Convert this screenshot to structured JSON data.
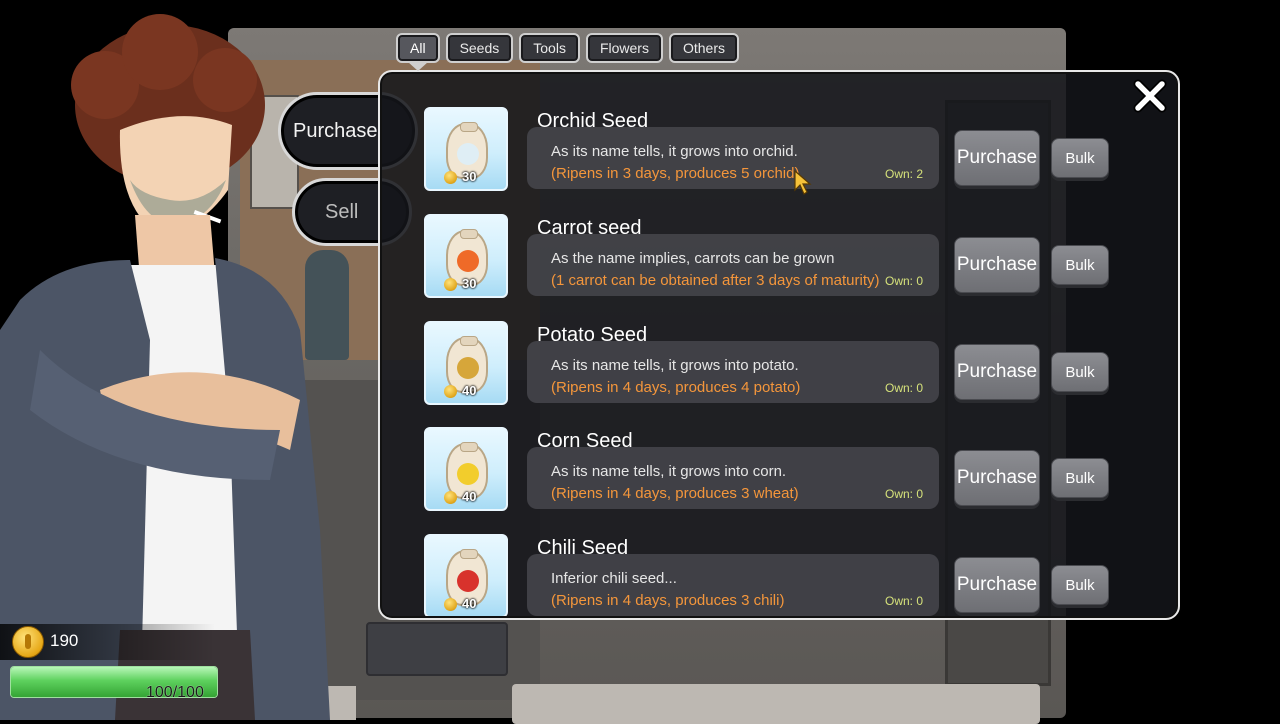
{
  "tabs": [
    {
      "label": "All",
      "active": true
    },
    {
      "label": "Seeds",
      "active": false
    },
    {
      "label": "Tools",
      "active": false
    },
    {
      "label": "Flowers",
      "active": false
    },
    {
      "label": "Others",
      "active": false
    }
  ],
  "side_menu": {
    "purchase_label": "Purchase",
    "sell_label": "Sell"
  },
  "hud": {
    "money": "190",
    "hp_text": "100/100",
    "hp_fraction": 1.0
  },
  "items": [
    {
      "name": "Orchid Seed",
      "price": "30",
      "icon": "orchid-seed-icon",
      "glyph_color": "#dfeef5",
      "description": "As its name tells, it grows into orchid.",
      "yield": "(Ripens in 3 days, produces 5 orchid)",
      "own": "Own:  2"
    },
    {
      "name": "Carrot seed",
      "price": "30",
      "icon": "carrot-seed-icon",
      "glyph_color": "#ef6a28",
      "description": "As the name implies, carrots can be grown",
      "yield": "(1 carrot can be obtained after 3 days of maturity)",
      "own": "Own:  0"
    },
    {
      "name": "Potato Seed",
      "price": "40",
      "icon": "potato-seed-icon",
      "glyph_color": "#d6a63a",
      "description": "As its name tells, it grows into potato.",
      "yield": "(Ripens in 4 days, produces 4 potato)",
      "own": "Own:  0"
    },
    {
      "name": "Corn Seed",
      "price": "40",
      "icon": "corn-seed-icon",
      "glyph_color": "#f2cd2c",
      "description": "As its name tells, it grows into corn.",
      "yield": "(Ripens in 4 days, produces 3 wheat)",
      "own": "Own:  0"
    },
    {
      "name": "Chili Seed",
      "price": "40",
      "icon": "chili-seed-icon",
      "glyph_color": "#d8322c",
      "description": "Inferior chili seed...",
      "yield": "(Ripens in 4 days, produces 3 chili)",
      "own": "Own:  0"
    }
  ],
  "buttons": {
    "purchase_label": "Purchase",
    "bulk_label": "Bulk"
  },
  "colors": {
    "yield_text": "#f4963b",
    "own_text": "#d6e27b",
    "hp_bar": "#5ed15e"
  }
}
